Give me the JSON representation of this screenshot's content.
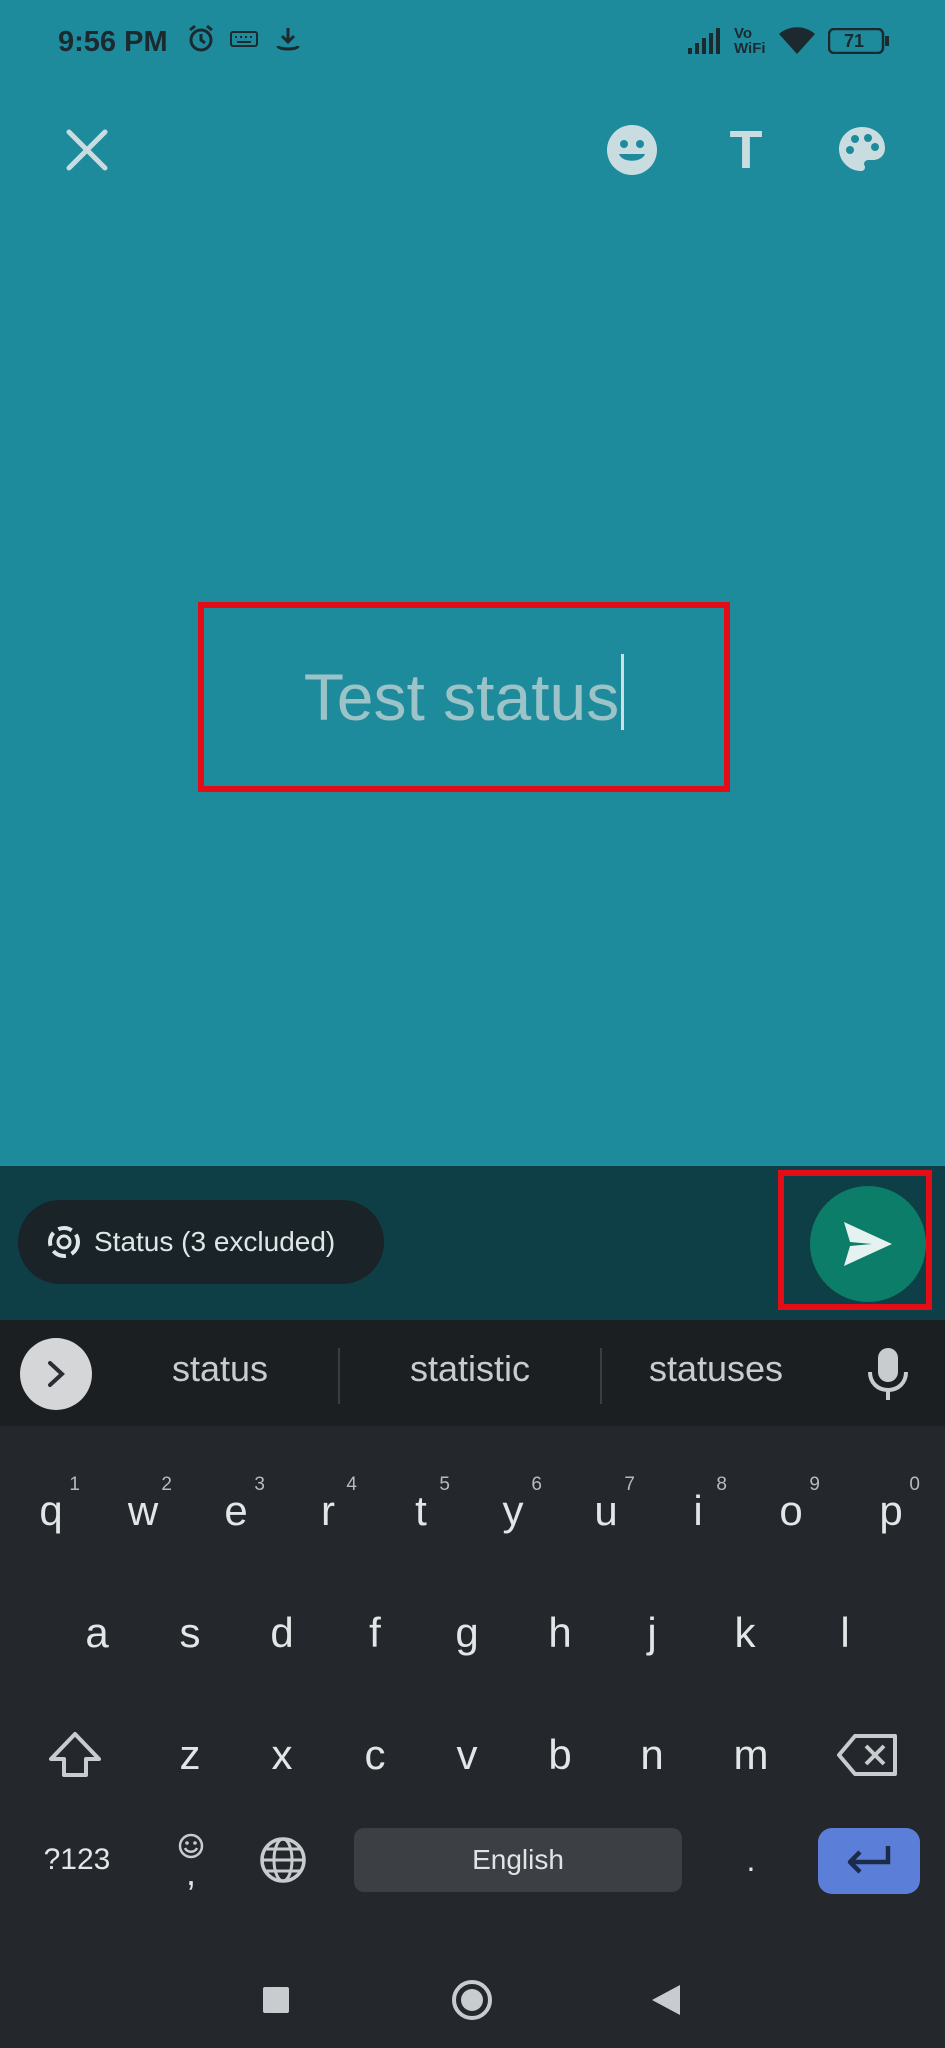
{
  "status_bar": {
    "time": "9:56 PM",
    "battery": "71",
    "icons": [
      "alarm-icon",
      "keyboard-icon",
      "download-icon",
      "signal-icon",
      "vowifi-icon",
      "wifi-icon",
      "battery-icon"
    ],
    "vowifi_top": "Vo",
    "vowifi_bottom": "WiFi"
  },
  "toolbar": {
    "close_icon": "close-icon",
    "emoji_icon": "emoji-icon",
    "text_label": "T",
    "palette_icon": "palette-icon"
  },
  "composer": {
    "status_text": "Test status"
  },
  "audience": {
    "label": "Status (3 excluded)",
    "icon": "status-ring-icon"
  },
  "send": {
    "icon": "send-icon"
  },
  "keyboard": {
    "suggestions": [
      "status",
      "statistic",
      "statuses"
    ],
    "row1": [
      {
        "k": "q",
        "h": "1"
      },
      {
        "k": "w",
        "h": "2"
      },
      {
        "k": "e",
        "h": "3"
      },
      {
        "k": "r",
        "h": "4"
      },
      {
        "k": "t",
        "h": "5"
      },
      {
        "k": "y",
        "h": "6"
      },
      {
        "k": "u",
        "h": "7"
      },
      {
        "k": "i",
        "h": "8"
      },
      {
        "k": "o",
        "h": "9"
      },
      {
        "k": "p",
        "h": "0"
      }
    ],
    "row2": [
      "a",
      "s",
      "d",
      "f",
      "g",
      "h",
      "j",
      "k",
      "l"
    ],
    "row3": [
      "z",
      "x",
      "c",
      "v",
      "b",
      "n",
      "m"
    ],
    "symbols_label": "?123",
    "comma_label": ",",
    "space_label": "English",
    "period_label": "."
  },
  "colors": {
    "background": "#1e8b9c",
    "panel": "#0e3f47",
    "send": "#0c7d68",
    "highlight": "#e30d17",
    "enter_key": "#5b7fd8"
  }
}
